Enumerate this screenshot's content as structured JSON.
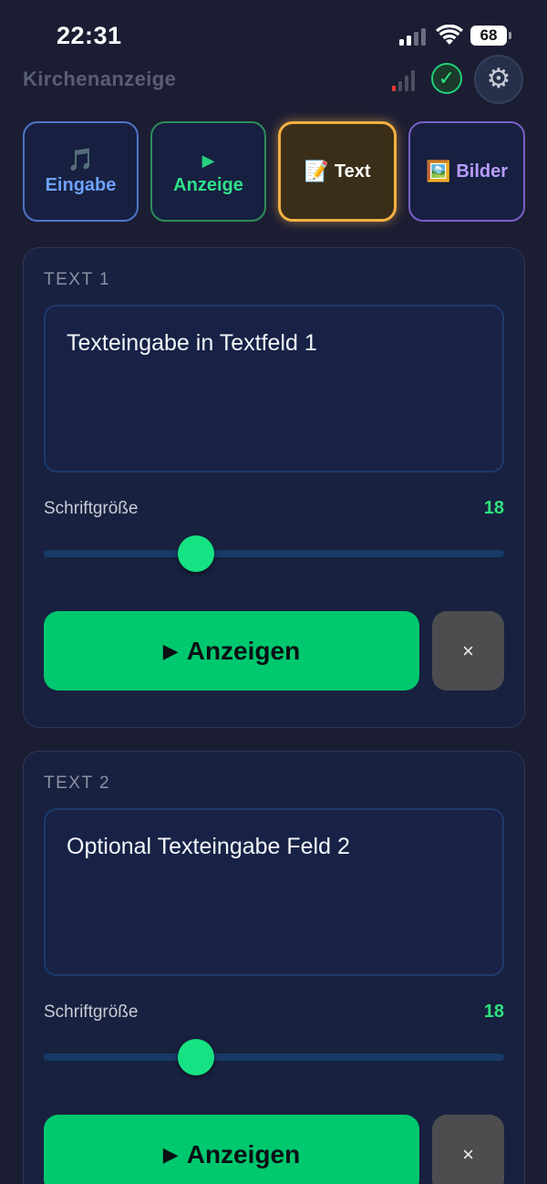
{
  "status_bar": {
    "time": "22:31",
    "battery": "68"
  },
  "header": {
    "title": "Kirchenanzeige",
    "check_glyph": "✓",
    "gear_glyph": "⚙"
  },
  "tabs": [
    {
      "icon": "🎵",
      "label": "Eingabe",
      "color": "#6ea2ff"
    },
    {
      "icon": "▶",
      "label": "Anzeige",
      "color": "#2fe08a"
    },
    {
      "icon": "📝",
      "label": "Text",
      "color": "#f5b042",
      "active": true
    },
    {
      "icon": "🖼️",
      "label": "Bilder",
      "color": "#b99cff"
    }
  ],
  "cards": [
    {
      "label": "TEXT 1",
      "text": "Texteingabe in Textfeld 1",
      "size_label": "Schriftgröße",
      "size_value": "18",
      "slider_fraction": 0.33,
      "show_label": "Anzeigen",
      "clear_label": "×"
    },
    {
      "label": "TEXT 2",
      "text": "Optional Texteingabe Feld 2",
      "size_label": "Schriftgröße",
      "size_value": "18",
      "slider_fraction": 0.33,
      "show_label": "Anzeigen",
      "clear_label": "×"
    }
  ],
  "colors": {
    "accent": "#00c86e",
    "background": "#1b1d33",
    "card": "#18213f"
  }
}
